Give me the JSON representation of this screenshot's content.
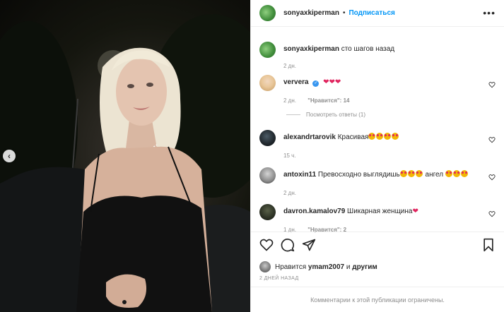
{
  "post": {
    "author": "sonyaxkiperman",
    "dot": "•",
    "follow_label": "Подписаться",
    "more_label": "•••"
  },
  "caption": {
    "username": "sonyaxkiperman",
    "text": "сто шагов назад",
    "time": "2 дн."
  },
  "comments": [
    {
      "username": "ververa",
      "verified": true,
      "time": "2 дн.",
      "likes": "\"Нравится\": 14",
      "replies": "Посмотреть ответы (1)"
    },
    {
      "username": "alexandrtarovik",
      "text": "Красивая",
      "time": "15 ч."
    },
    {
      "username": "antoxin11",
      "text": "Превосходно выглядишь",
      "text2": "ангел",
      "time": "2 дн."
    },
    {
      "username": "davron.kamalov79",
      "text": "Шикарная женщина",
      "time": "1 дн.",
      "likes": "\"Нравится\": 2"
    }
  ],
  "likes": {
    "prefix": "Нравится",
    "user": "ymam2007",
    "conj": "и",
    "others": "другим"
  },
  "posted_time": "2 ДНЕЙ НАЗАД",
  "comments_limited": "Комментарии к этой публикации ограничены.",
  "icons": {
    "prev": "chevron-left-icon",
    "like": "heart-icon",
    "comment": "comment-icon",
    "share": "paper-plane-icon",
    "save": "bookmark-icon"
  },
  "colors": {
    "accent": "#0095f6",
    "meta": "#8e8e8e",
    "text": "#262626",
    "heart": "#e0245e"
  }
}
